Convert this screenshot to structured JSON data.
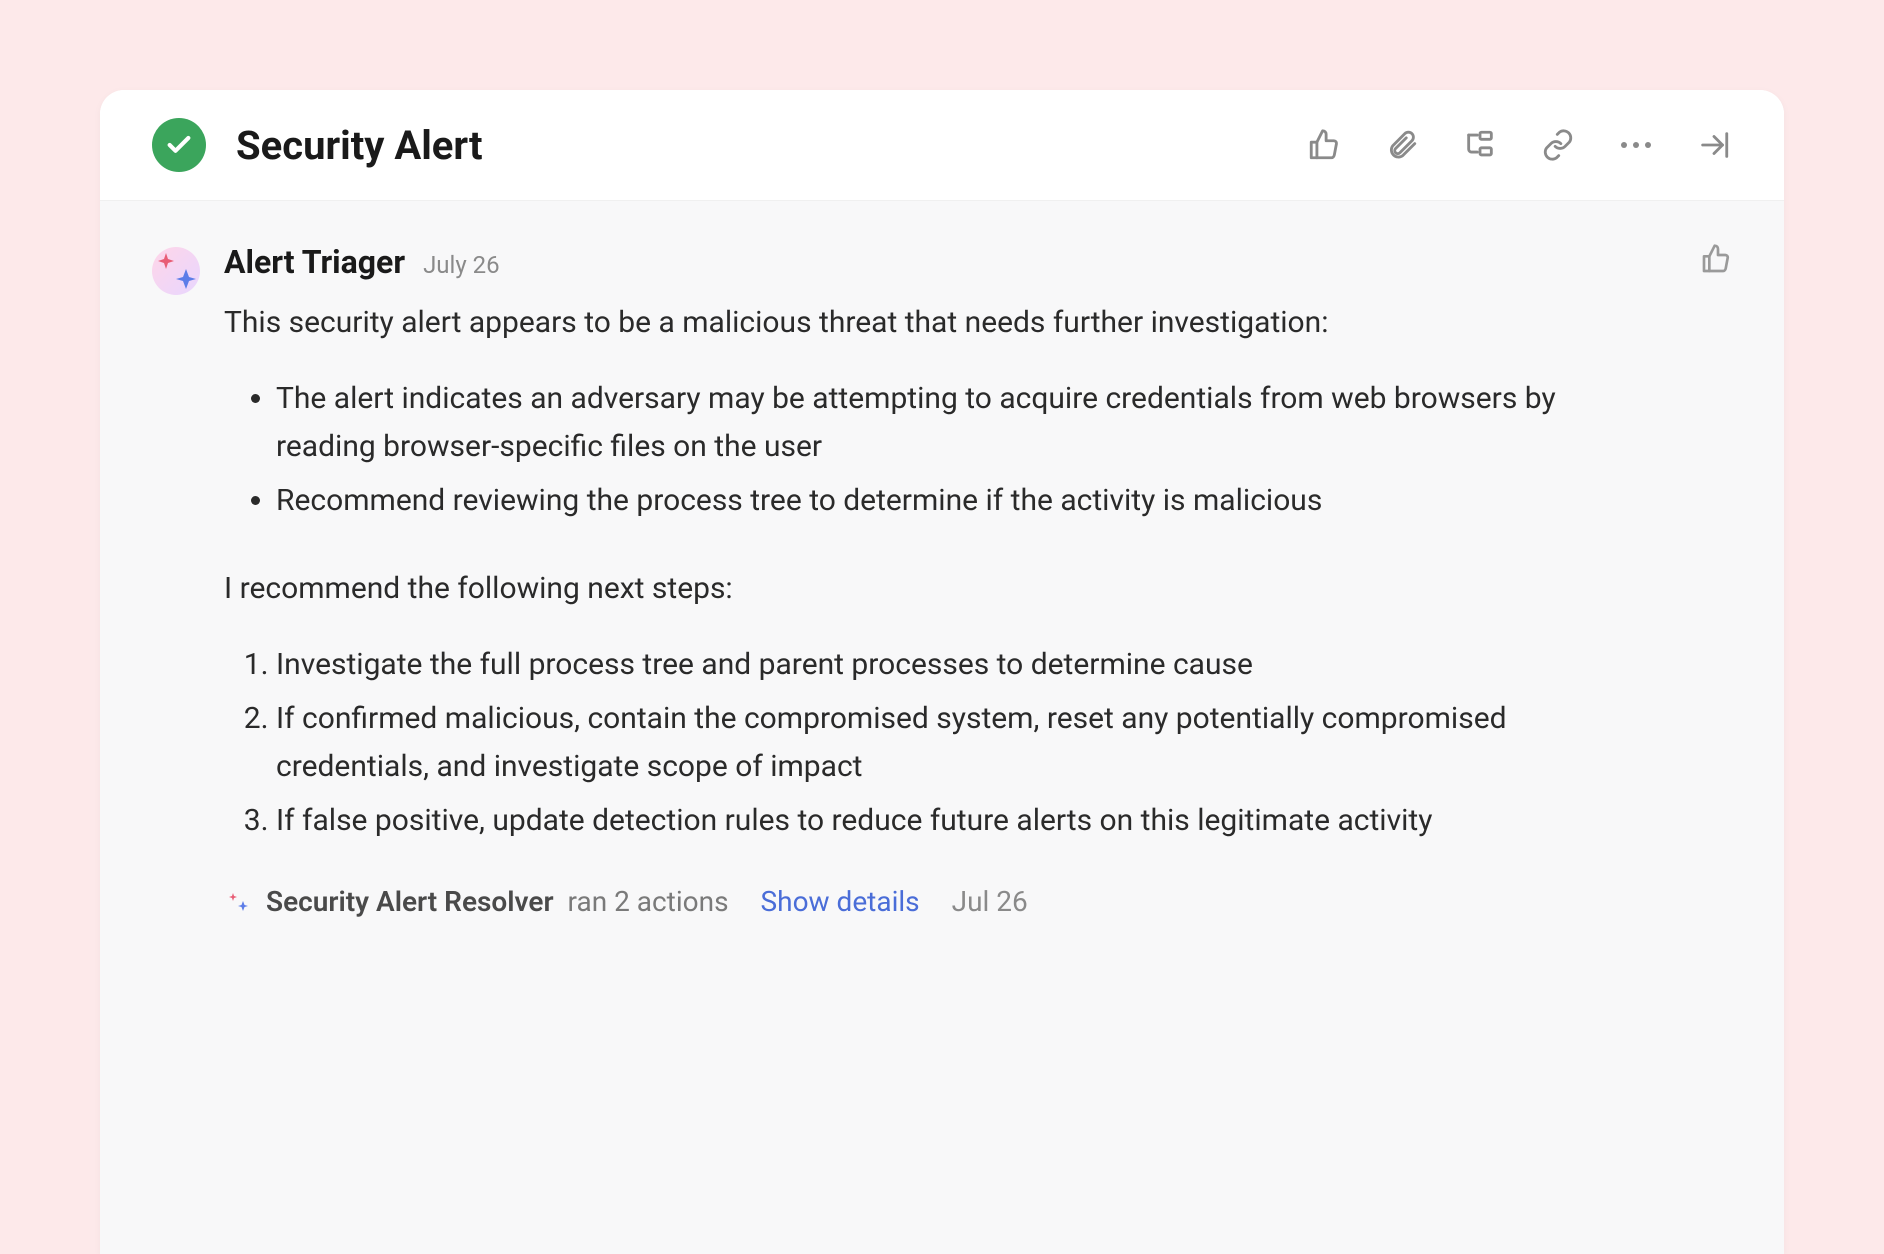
{
  "header": {
    "title": "Security Alert"
  },
  "comment": {
    "author": "Alert Triager",
    "date": "July 26",
    "intro": "This security alert appears to be a malicious threat that needs further investigation:",
    "bullets": [
      "The alert indicates an adversary may be attempting to acquire credentials from web browsers by reading browser-specific files on the user",
      "Recommend reviewing the process tree to determine if the activity is malicious"
    ],
    "recommend_intro": "I recommend the following next steps:",
    "steps": [
      "Investigate the full process tree and parent processes to determine cause",
      "If confirmed malicious, contain the compromised system, reset any potentially compromised credentials, and investigate scope of impact",
      "If false positive, update detection rules to reduce future alerts on this legitimate activity"
    ]
  },
  "footer": {
    "resolver_name": "Security Alert Resolver",
    "resolver_action": "ran 2 actions",
    "details_link": "Show details",
    "date": "Jul 26"
  }
}
